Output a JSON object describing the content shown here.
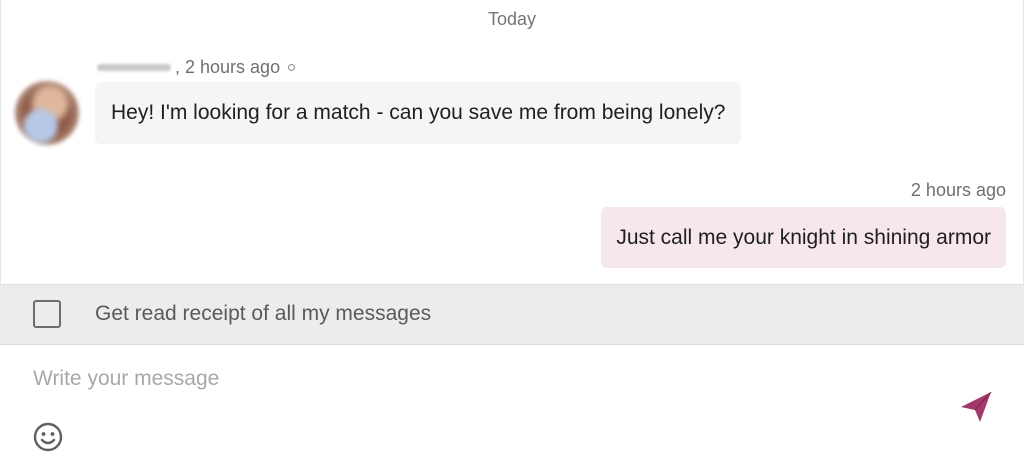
{
  "chat": {
    "day_separator": "Today",
    "incoming": {
      "time": ", 2 hours ago",
      "text": "Hey! I'm looking for a match - can you save me from being lonely?"
    },
    "outgoing": {
      "time": "2 hours ago",
      "text": "Just call me your knight in shining armor"
    }
  },
  "read_receipt": {
    "label": "Get read receipt of all my messages",
    "checked": false
  },
  "composer": {
    "placeholder": "Write your message",
    "value": "",
    "emoji_icon": "smiley-icon",
    "send_icon": "paper-plane-send-icon"
  },
  "colors": {
    "accent": "#a3386c",
    "outgoing_bubble": "#f6e6ee",
    "incoming_bubble": "#f5f5f5",
    "receipt_bar": "#ececec"
  }
}
